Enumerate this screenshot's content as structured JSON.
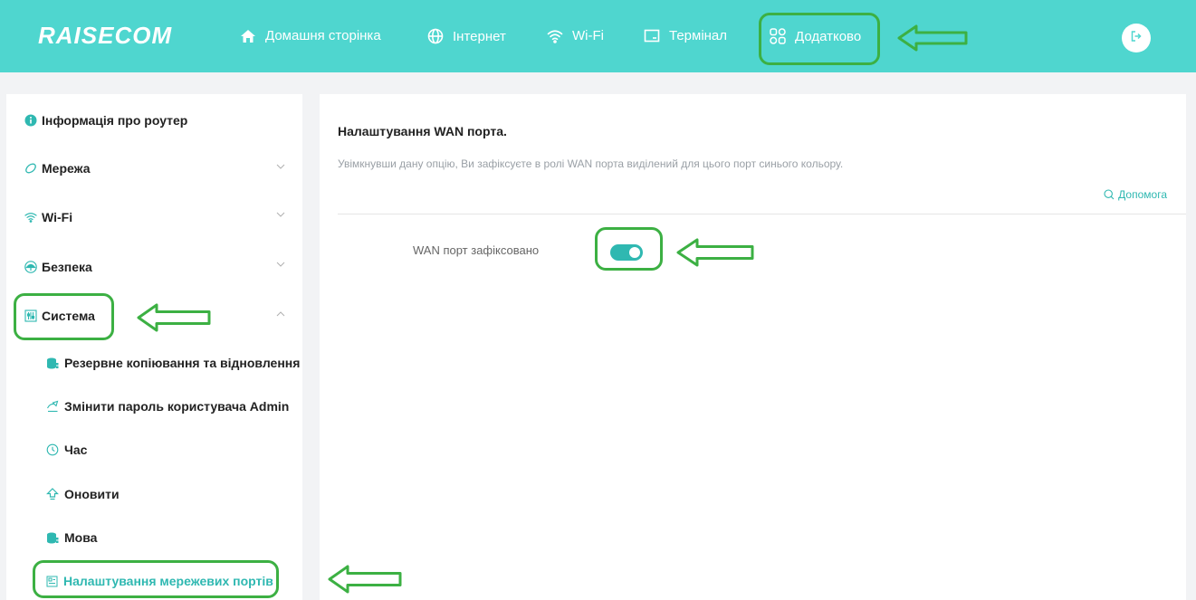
{
  "header": {
    "logo": "RAISECOM",
    "nav": [
      {
        "label": "Домашня сторінка",
        "icon": "home-icon"
      },
      {
        "label": "Інтернет",
        "icon": "globe-icon"
      },
      {
        "label": "Wi-Fi",
        "icon": "wifi-icon"
      },
      {
        "label": "Термінал",
        "icon": "monitor-icon"
      },
      {
        "label": "Додатково",
        "icon": "grid-icon"
      }
    ],
    "logout_icon": "logout-icon"
  },
  "sidebar": {
    "items": [
      {
        "label": "Інформація про роутер",
        "icon": "info-icon"
      },
      {
        "label": "Мережа",
        "icon": "network-icon"
      },
      {
        "label": "Wi-Fi",
        "icon": "wifi-icon"
      },
      {
        "label": "Безпека",
        "icon": "umbrella-icon"
      },
      {
        "label": "Система",
        "icon": "system-icon"
      }
    ],
    "sub_items": [
      {
        "label": "Резервне копіювання та відновлення",
        "icon": "database-icon"
      },
      {
        "label": "Змінити пароль користувача Admin",
        "icon": "edit-icon"
      },
      {
        "label": "Час",
        "icon": "clock-icon"
      },
      {
        "label": "Оновити",
        "icon": "upload-icon"
      },
      {
        "label": "Мова",
        "icon": "database-icon"
      },
      {
        "label": "Налаштування мережевих портів",
        "icon": "port-icon"
      }
    ]
  },
  "main": {
    "title": "Налаштування WAN порта.",
    "description": "Увімкнувши дану опцію, Ви зафіксуєте в ролі WAN порта виділений для цього порт синього кольору.",
    "help_label": "Допомога",
    "field_label": "WAN порт зафіксовано",
    "wan_fixed_enabled": true
  },
  "colors": {
    "header_bg": "#4fd6cf",
    "accent": "#2fb8b1",
    "annotation": "#3cb043"
  }
}
